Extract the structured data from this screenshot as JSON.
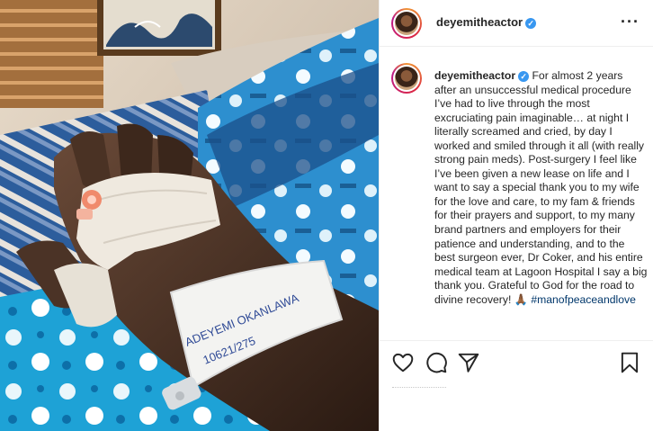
{
  "post": {
    "username": "deyemitheactor",
    "verified_mark": "✓",
    "more_label": "···",
    "photo_alt_icon": "hospital-hand-photo",
    "wristband_line1": "ADEYEMI OKANLAWA",
    "wristband_line2": "10621/275"
  },
  "caption": {
    "username": "deyemitheactor",
    "text": "For almost 2 years after an unsuccessful medical procedure I’ve had to live through the most excruciating pain imaginable… at night I literally screamed and cried, by day I worked and smiled through it all (with really strong pain meds). Post-surgery I feel like I’ve been given a new lease on life and I want to say a special thank you to my wife for the love and care, to my fam & friends for their prayers and support, to my many brand partners and employers for their patience and understanding, and to the best surgeon ever, Dr Coker, and his entire medical team at Lagoon Hospital I say a big thank you. Grateful to God for the road to divine recovery! ",
    "emoji": "🙏🏾",
    "hashtag": "#manofpeaceandlove"
  },
  "actions": {
    "like_icon": "heart-icon",
    "comment_icon": "comment-icon",
    "share_icon": "paper-plane-icon",
    "save_icon": "bookmark-icon"
  },
  "colors": {
    "verified_blue": "#3897f0",
    "hashtag_blue": "#00376b",
    "text_dark": "#262626"
  }
}
